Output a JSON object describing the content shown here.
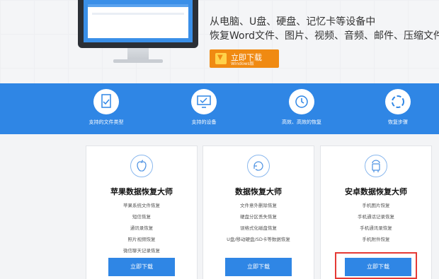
{
  "hero": {
    "line1": "从电脑、U盘、硬盘、记忆卡等设备中",
    "line2": "恢复Word文件、图片、视频、音频、邮件、压缩文件等",
    "download_label": "立即下载",
    "download_sub": "Windows版"
  },
  "features": [
    {
      "label": "支持的文件类型",
      "icon": "file-check-icon"
    },
    {
      "label": "支持的设备",
      "icon": "monitor-check-icon"
    },
    {
      "label": "高效、高效的恢复",
      "icon": "clock-history-icon"
    },
    {
      "label": "恢复步骤",
      "icon": "cycle-steps-icon"
    }
  ],
  "cards": [
    {
      "title": "苹果数据恢复大师",
      "icon": "apple-icon",
      "items": [
        "苹果系统文件恢复",
        "短信恢复",
        "通讯录恢复",
        "照片视频恢复",
        "微信聊天记录恢复"
      ],
      "button": "立即下载"
    },
    {
      "title": "数据恢复大师",
      "icon": "recovery-icon",
      "items": [
        "文件意外删除恢复",
        "硬盘分区丢失恢复",
        "误格式化磁盘恢复",
        "U盘/移动硬盘/SD卡等数据恢复"
      ],
      "button": "立即下载"
    },
    {
      "title": "安卓数据恢复大师",
      "icon": "android-icon",
      "items": [
        "手机图片恢复",
        "手机通话记录恢复",
        "手机通讯录恢复",
        "手机附件恢复"
      ],
      "button": "立即下载"
    }
  ],
  "colors": {
    "brand_blue": "#2f86e5",
    "download_orange": "#f08a12",
    "highlight_red": "#e53935"
  }
}
